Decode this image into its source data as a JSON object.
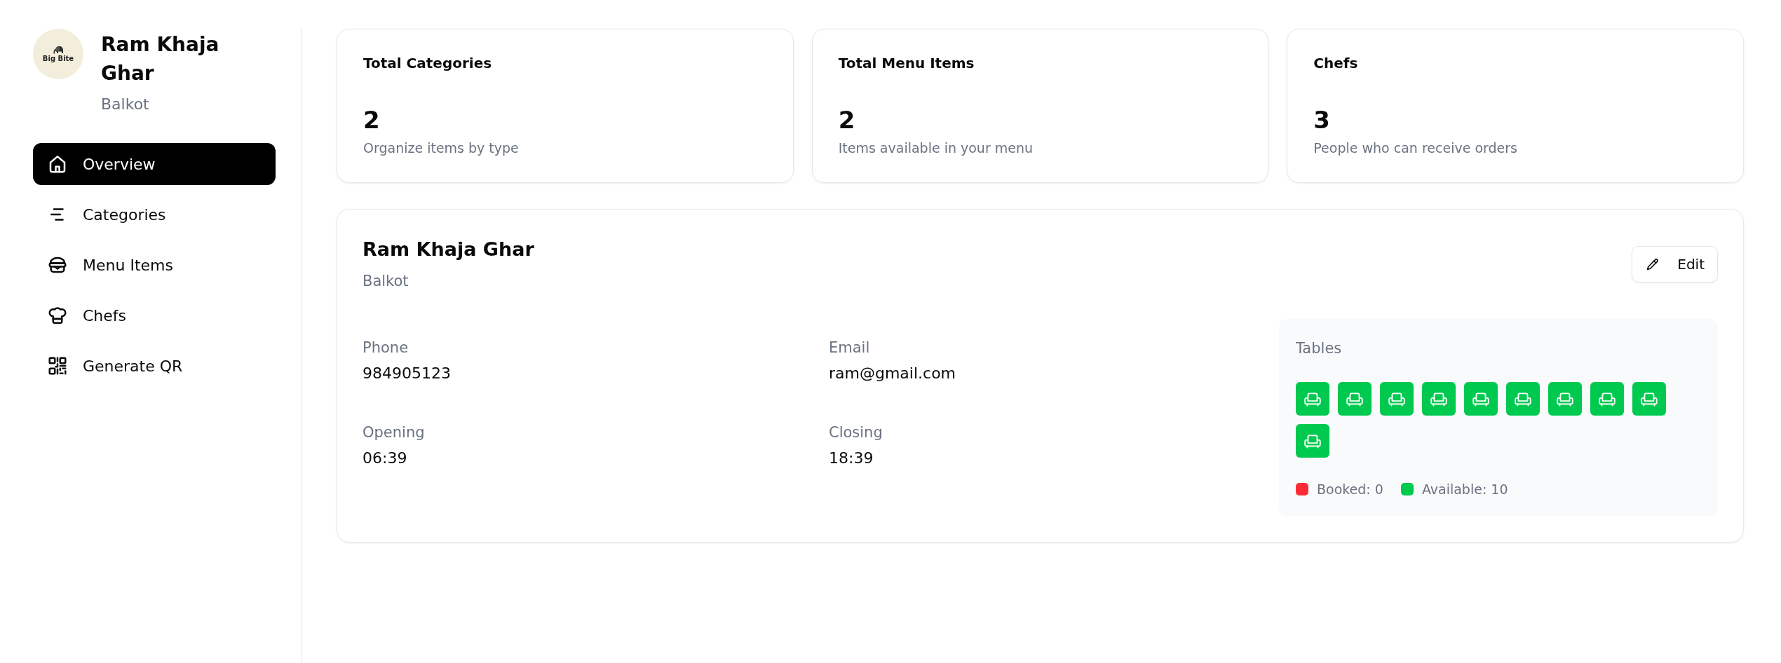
{
  "sidebar": {
    "logo_text": "Big Bite",
    "restaurant_name": "Ram Khaja Ghar",
    "location": "Balkot",
    "nav": [
      {
        "label": "Overview",
        "selected": true
      },
      {
        "label": "Categories",
        "selected": false
      },
      {
        "label": "Menu Items",
        "selected": false
      },
      {
        "label": "Chefs",
        "selected": false
      },
      {
        "label": "Generate QR",
        "selected": false
      }
    ]
  },
  "stats": [
    {
      "title": "Total Categories",
      "value": "2",
      "description": "Organize items by type"
    },
    {
      "title": "Total Menu Items",
      "value": "2",
      "description": "Items available in your menu"
    },
    {
      "title": "Chefs",
      "value": "3",
      "description": "People who can receive orders"
    }
  ],
  "restaurant": {
    "name": "Ram Khaja Ghar",
    "location": "Balkot",
    "edit_button": "Edit",
    "fields": [
      {
        "label": "Phone",
        "value": "984905123"
      },
      {
        "label": "Email",
        "value": "ram@gmail.com"
      },
      {
        "label": "Opening",
        "value": "06:39"
      },
      {
        "label": "Closing",
        "value": "18:39"
      }
    ],
    "tables": {
      "title": "Tables",
      "items": [
        {
          "booked": false
        },
        {
          "booked": false
        },
        {
          "booked": false
        },
        {
          "booked": false
        },
        {
          "booked": false
        },
        {
          "booked": false
        },
        {
          "booked": false
        },
        {
          "booked": false
        },
        {
          "booked": false
        },
        {
          "booked": false
        }
      ],
      "legend": [
        {
          "label": "Booked: 0",
          "color": "#fb2c36"
        },
        {
          "label": "Available: 10",
          "color": "#00c950"
        }
      ]
    }
  }
}
